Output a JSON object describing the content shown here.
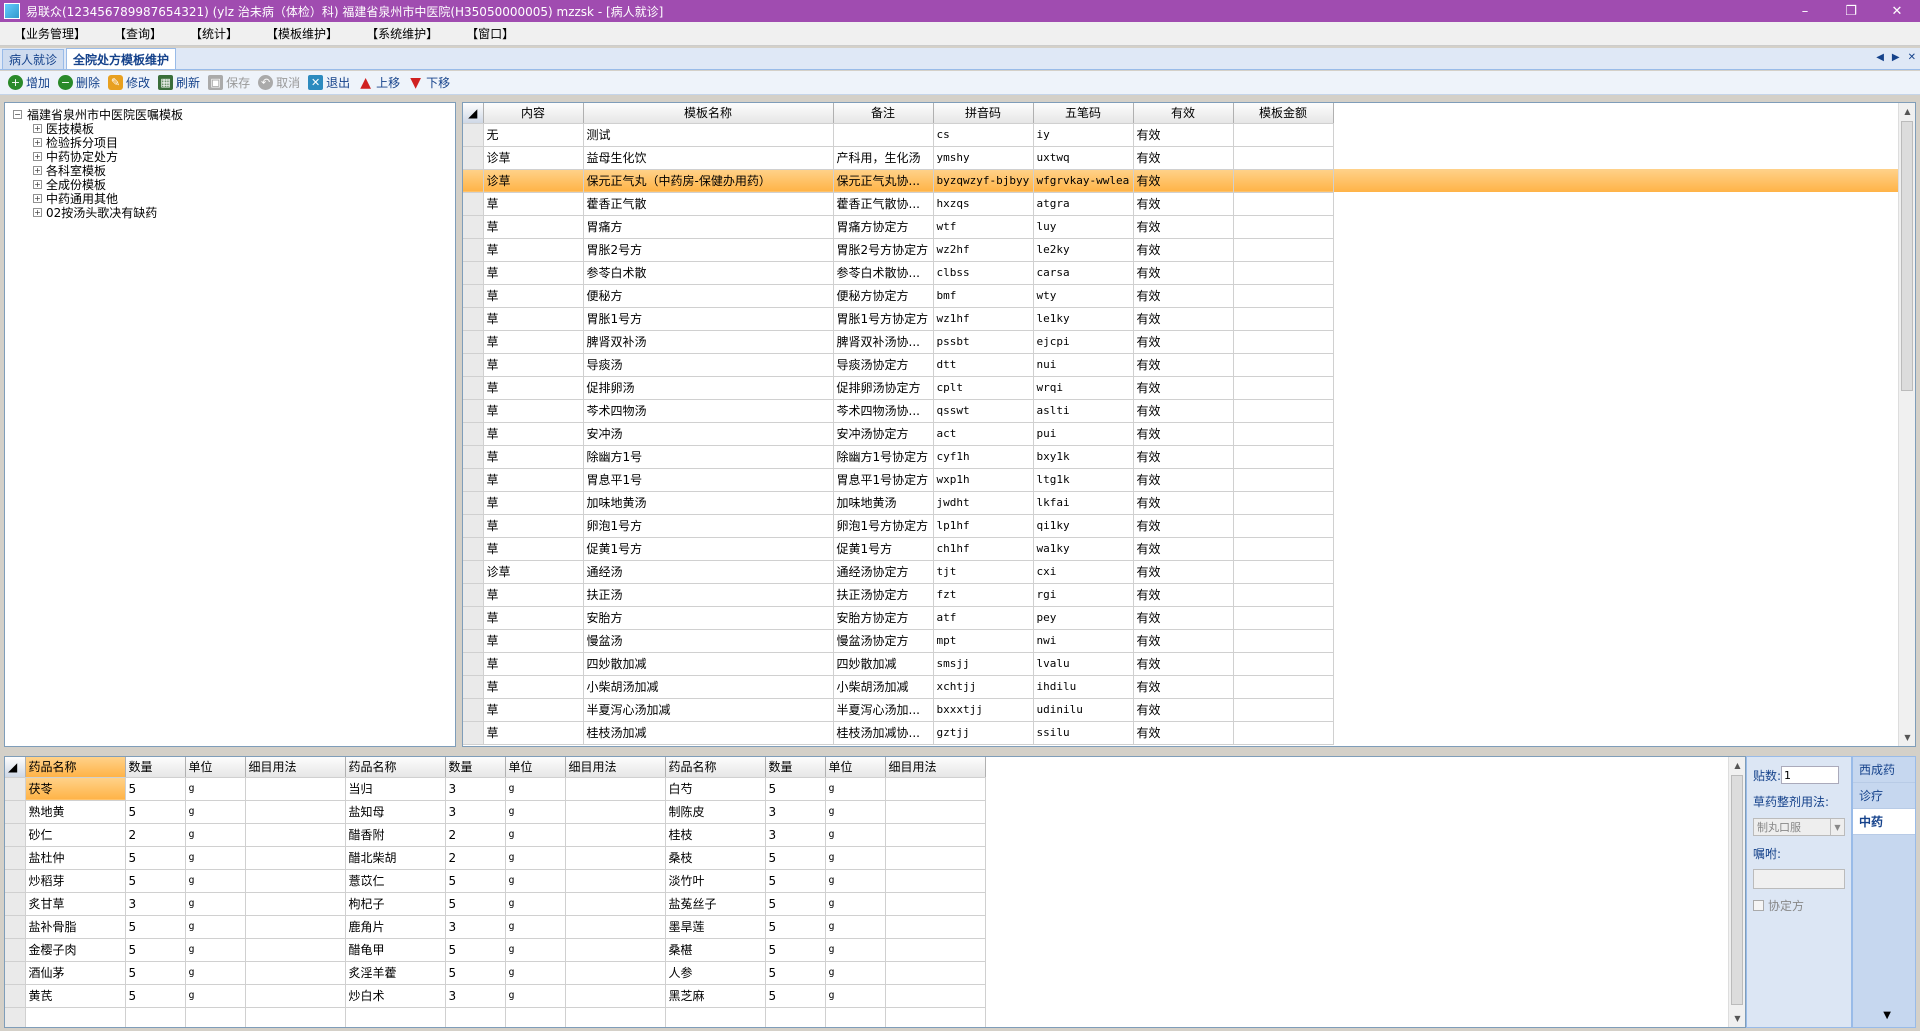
{
  "titlebar": {
    "title": "易联众(123456789987654321) (ylz 治未病（体检）科) 福建省泉州市中医院(H35050000005) mzzsk - [病人就诊]",
    "min": "–",
    "max": "❐",
    "close": "✕"
  },
  "menu": [
    "【业务管理】",
    "【查询】",
    "【统计】",
    "【模板维护】",
    "【系统维护】",
    "【窗口】"
  ],
  "tabs": [
    {
      "label": "病人就诊",
      "active": false
    },
    {
      "label": "全院处方模板维护",
      "active": true
    }
  ],
  "tabctl": {
    "prev": "◀",
    "next": "▶",
    "close": "✕"
  },
  "toolbar": {
    "add": "增加",
    "delete": "删除",
    "edit": "修改",
    "refresh": "刷新",
    "save": "保存",
    "cancel": "取消",
    "exit": "退出",
    "up": "上移",
    "down": "下移"
  },
  "tree": {
    "root": "福建省泉州市中医院医嘱模板",
    "nodes": [
      "医技模板",
      "检验拆分项目",
      "中药协定处方",
      "各科室模板",
      "全成份模板",
      "中药通用其他",
      "02按汤头歌决有缺药"
    ]
  },
  "template_grid": {
    "columns": [
      "内容",
      "模板名称",
      "备注",
      "拼音码",
      "五笔码",
      "有效",
      "模板金额"
    ],
    "rows": [
      [
        "无",
        "测试",
        "",
        "cs",
        "iy",
        "有效",
        ""
      ],
      [
        "诊草",
        "益母生化饮",
        "产科用，生化汤",
        "ymshy",
        "uxtwq",
        "有效",
        ""
      ],
      [
        "诊草",
        "保元正气丸（中药房-保健办用药）",
        "保元正气丸协...",
        "byzqwzyf-bjbyy",
        "wfgrvkay-wwlea",
        "有效",
        ""
      ],
      [
        "草",
        "藿香正气散",
        "藿香正气散协...",
        "hxzqs",
        "atgra",
        "有效",
        ""
      ],
      [
        "草",
        "胃痛方",
        "胃痛方协定方",
        "wtf",
        "luy",
        "有效",
        ""
      ],
      [
        "草",
        "胃胀2号方",
        "胃胀2号方协定方",
        "wz2hf",
        "le2ky",
        "有效",
        ""
      ],
      [
        "草",
        "参苓白术散",
        "参苓白术散协...",
        "clbss",
        "carsa",
        "有效",
        ""
      ],
      [
        "草",
        "便秘方",
        "便秘方协定方",
        "bmf",
        "wty",
        "有效",
        ""
      ],
      [
        "草",
        "胃胀1号方",
        "胃胀1号方协定方",
        "wz1hf",
        "le1ky",
        "有效",
        ""
      ],
      [
        "草",
        "脾肾双补汤",
        "脾肾双补汤协...",
        "pssbt",
        "ejcpi",
        "有效",
        ""
      ],
      [
        "草",
        "导痰汤",
        "导痰汤协定方",
        "dtt",
        "nui",
        "有效",
        ""
      ],
      [
        "草",
        "促排卵汤",
        "促排卵汤协定方",
        "cplt",
        "wrqi",
        "有效",
        ""
      ],
      [
        "草",
        "芩术四物汤",
        "芩术四物汤协...",
        "qsswt",
        "aslti",
        "有效",
        ""
      ],
      [
        "草",
        "安冲汤",
        "安冲汤协定方",
        "act",
        "pui",
        "有效",
        ""
      ],
      [
        "草",
        "除幽方1号",
        "除幽方1号协定方",
        "cyf1h",
        "bxy1k",
        "有效",
        ""
      ],
      [
        "草",
        "胃息平1号",
        "胃息平1号协定方",
        "wxp1h",
        "ltg1k",
        "有效",
        ""
      ],
      [
        "草",
        "加味地黄汤",
        "加味地黄汤",
        "jwdht",
        "lkfai",
        "有效",
        ""
      ],
      [
        "草",
        "卵泡1号方",
        "卵泡1号方协定方",
        "lp1hf",
        "qi1ky",
        "有效",
        ""
      ],
      [
        "草",
        "促黄1号方",
        "促黄1号方",
        "ch1hf",
        "wa1ky",
        "有效",
        ""
      ],
      [
        "诊草",
        "通经汤",
        "通经汤协定方",
        "tjt",
        "cxi",
        "有效",
        ""
      ],
      [
        "草",
        "扶正汤",
        "扶正汤协定方",
        "fzt",
        "rgi",
        "有效",
        ""
      ],
      [
        "草",
        "安胎方",
        "安胎方协定方",
        "atf",
        "pey",
        "有效",
        ""
      ],
      [
        "草",
        "慢盆汤",
        "慢盆汤协定方",
        "mpt",
        "nwi",
        "有效",
        ""
      ],
      [
        "草",
        "四妙散加减",
        "四妙散加减",
        "smsjj",
        "lvalu",
        "有效",
        ""
      ],
      [
        "草",
        "小柴胡汤加减",
        "小柴胡汤加减",
        "xchtjj",
        "ihdilu",
        "有效",
        ""
      ],
      [
        "草",
        "半夏泻心汤加减",
        "半夏泻心汤加...",
        "bxxxtjj",
        "udinilu",
        "有效",
        ""
      ],
      [
        "草",
        "桂枝汤加减",
        "桂枝汤加减协...",
        "gztjj",
        "ssilu",
        "有效",
        ""
      ]
    ],
    "highlight_row": 2
  },
  "drug_grid": {
    "columns": [
      "药品名称",
      "数量",
      "单位",
      "细目用法",
      "药品名称",
      "数量",
      "单位",
      "细目用法",
      "药品名称",
      "数量",
      "单位",
      "细目用法"
    ],
    "rows": [
      [
        "茯苓",
        "5",
        "g",
        "",
        "当归",
        "3",
        "g",
        "",
        "白芍",
        "5",
        "g",
        ""
      ],
      [
        "熟地黄",
        "5",
        "g",
        "",
        "盐知母",
        "3",
        "g",
        "",
        "制陈皮",
        "3",
        "g",
        ""
      ],
      [
        "砂仁",
        "2",
        "g",
        "",
        "醋香附",
        "2",
        "g",
        "",
        "桂枝",
        "3",
        "g",
        ""
      ],
      [
        "盐杜仲",
        "5",
        "g",
        "",
        "醋北柴胡",
        "2",
        "g",
        "",
        "桑枝",
        "5",
        "g",
        ""
      ],
      [
        "炒稻芽",
        "5",
        "g",
        "",
        "薏苡仁",
        "5",
        "g",
        "",
        "淡竹叶",
        "5",
        "g",
        ""
      ],
      [
        "炙甘草",
        "3",
        "g",
        "",
        "枸杞子",
        "5",
        "g",
        "",
        "盐菟丝子",
        "5",
        "g",
        ""
      ],
      [
        "盐补骨脂",
        "5",
        "g",
        "",
        "鹿角片",
        "3",
        "g",
        "",
        "墨旱莲",
        "5",
        "g",
        ""
      ],
      [
        "金樱子肉",
        "5",
        "g",
        "",
        "醋龟甲",
        "5",
        "g",
        "",
        "桑椹",
        "5",
        "g",
        ""
      ],
      [
        "酒仙茅",
        "5",
        "g",
        "",
        "炙淫羊藿",
        "5",
        "g",
        "",
        "人参",
        "5",
        "g",
        ""
      ],
      [
        "黄芪",
        "5",
        "g",
        "",
        "炒白术",
        "3",
        "g",
        "",
        "黑芝麻",
        "5",
        "g",
        ""
      ],
      [
        "",
        "",
        "",
        "",
        "",
        "",
        "",
        "",
        "",
        "",
        "",
        ""
      ]
    ]
  },
  "props": {
    "tieshu_label": "贴数:",
    "tieshu_value": "1",
    "usage_label": "草药整剂用法:",
    "usage_value": "制丸口服",
    "zhufu_label": "嘱咐:",
    "xieding_label": "协定方"
  },
  "side_tabs": [
    {
      "label": "西成药",
      "active": false
    },
    {
      "label": "诊疗",
      "active": false
    },
    {
      "label": "中药",
      "active": true
    }
  ]
}
